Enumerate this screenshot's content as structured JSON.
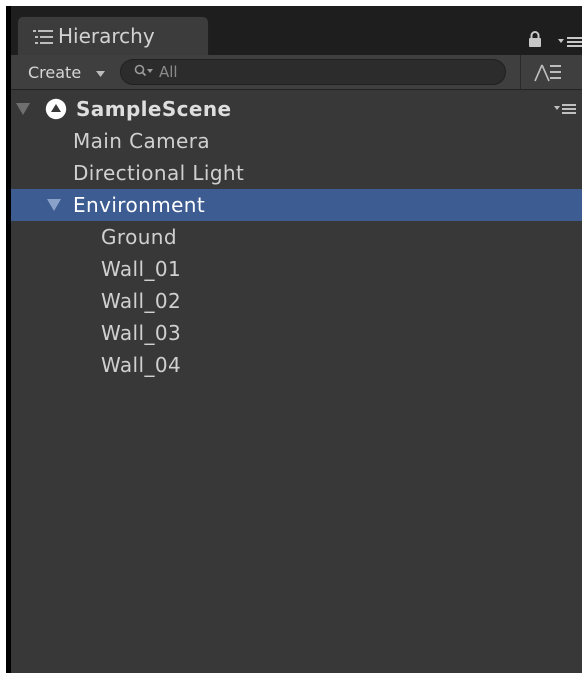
{
  "panel": {
    "tab_title": "Hierarchy"
  },
  "toolbar": {
    "create_label": "Create",
    "search_placeholder": "All"
  },
  "hierarchy": {
    "scene_name": "SampleScene",
    "items": [
      {
        "label": "Main Camera"
      },
      {
        "label": "Directional Light"
      },
      {
        "label": "Environment",
        "expanded": true,
        "selected": true
      },
      {
        "label": "Ground",
        "parent": "Environment"
      },
      {
        "label": "Wall_01",
        "parent": "Environment"
      },
      {
        "label": "Wall_02",
        "parent": "Environment"
      },
      {
        "label": "Wall_03",
        "parent": "Environment"
      },
      {
        "label": "Wall_04",
        "parent": "Environment"
      }
    ]
  },
  "colors": {
    "selection": "#3d5c91",
    "panel_background": "#383838",
    "toolbar_background": "#3f3f3f",
    "text": "#d0d0d0"
  },
  "icons": {
    "tab": "hierarchy-list-icon",
    "lock": "lock-icon",
    "tab_menu": "panel-menu-icon",
    "search": "search-icon",
    "filter": "scene-visibility-icon",
    "scene": "unity-logo-icon",
    "scene_menu": "scene-menu-icon"
  }
}
